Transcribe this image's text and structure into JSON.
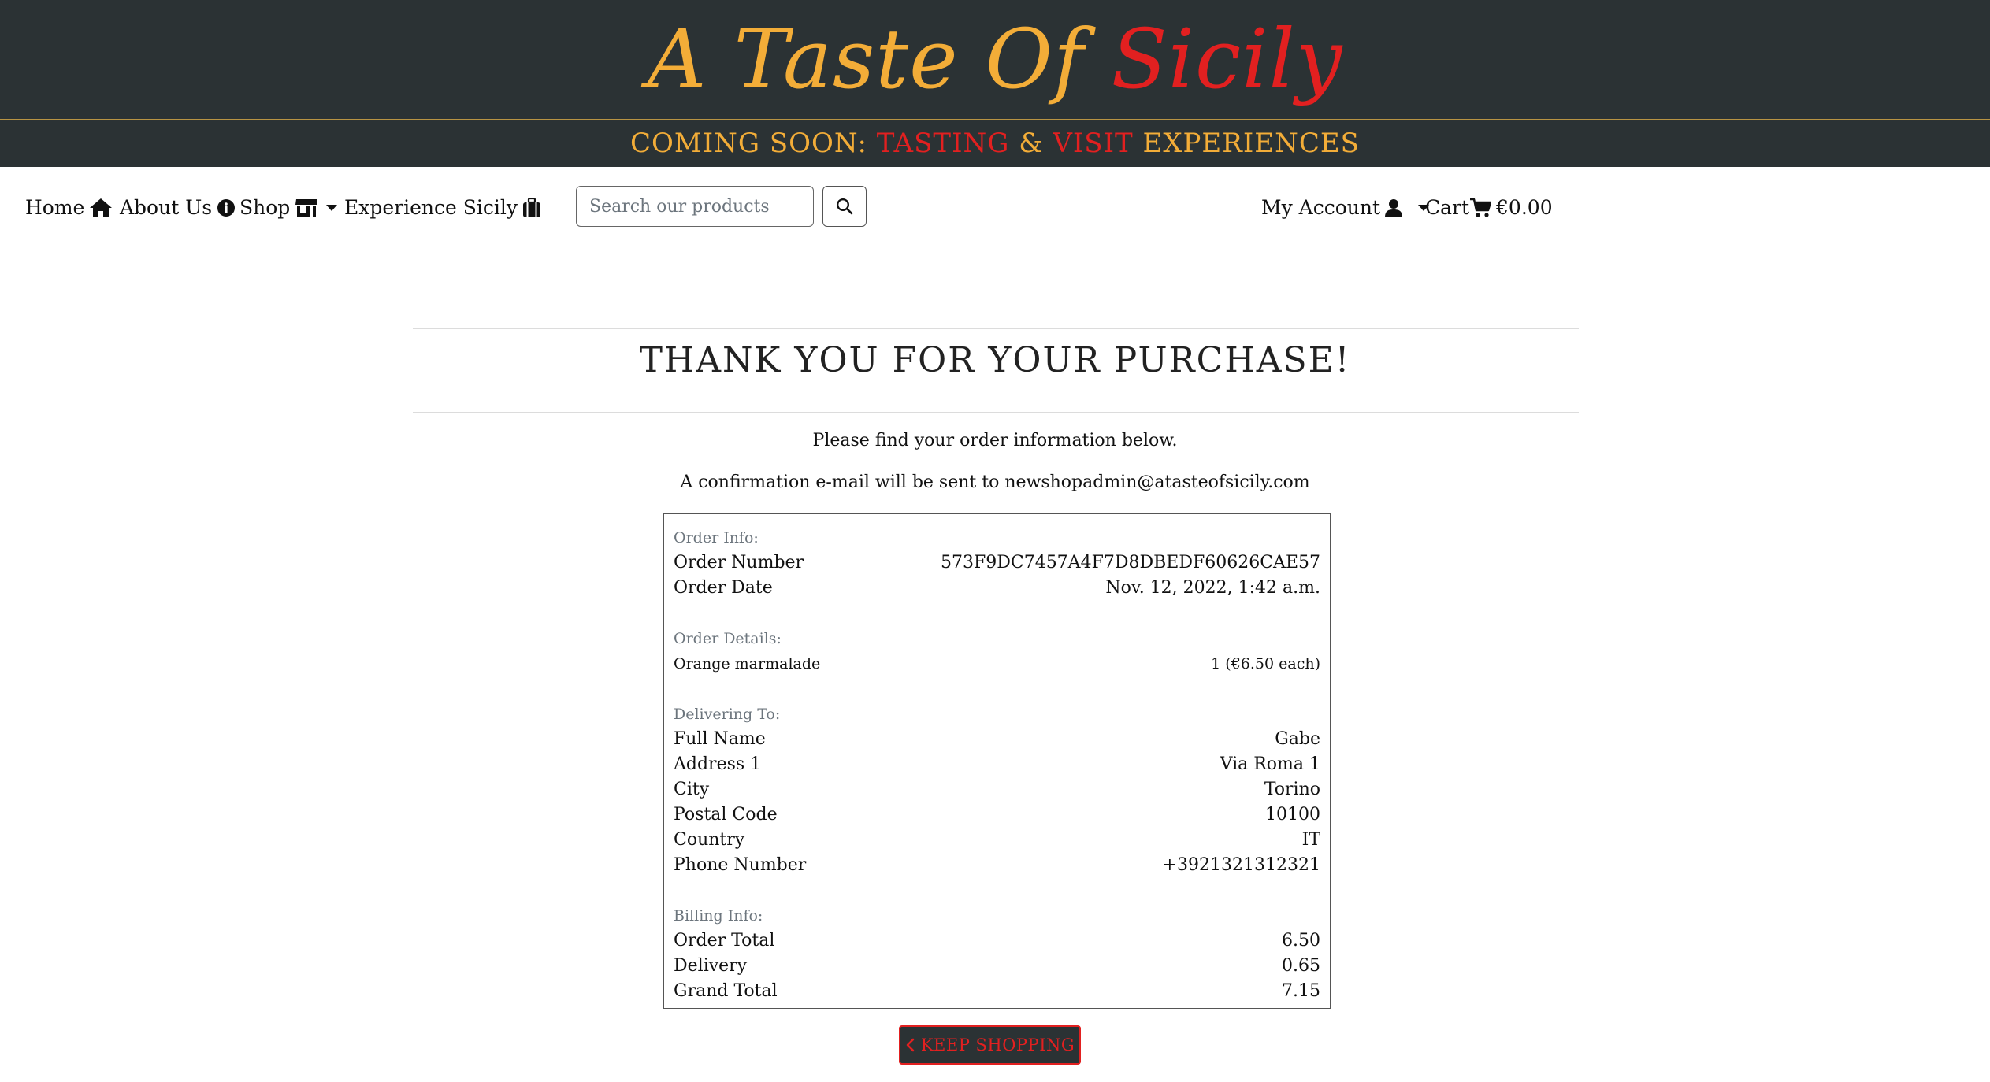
{
  "brand": {
    "word1": "A Taste",
    "word2": "Of",
    "word3": "Sicily"
  },
  "banner": {
    "part1": "COMING SOON: ",
    "part2": "TASTING",
    "part3": " & ",
    "part4": "VISIT",
    "part5": " EXPERIENCES"
  },
  "nav": {
    "home": "Home",
    "about": "About Us",
    "shop": "Shop",
    "experience": "Experience Sicily",
    "account": "My Account",
    "cart": "Cart",
    "cart_total": "€0.00"
  },
  "search": {
    "placeholder": "Search our products"
  },
  "main": {
    "title": "THANK YOU FOR YOUR PURCHASE!",
    "lead1": "Please find your order information below.",
    "lead2": "A confirmation e-mail will be sent to newshopadmin@atasteofsicily.com"
  },
  "order": {
    "info_label": "Order Info:",
    "number_label": "Order Number",
    "number_value": "573F9DC7457A4F7D8DBEDF60626CAE57",
    "date_label": "Order Date",
    "date_value": "Nov. 12, 2022, 1:42 a.m.",
    "details_label": "Order Details:",
    "items": [
      {
        "name": "Orange marmalade",
        "qty": "1 (€6.50 each)"
      }
    ],
    "delivering_label": "Delivering To:",
    "full_name_label": "Full Name",
    "full_name_value": "Gabe",
    "address1_label": "Address 1",
    "address1_value": "Via Roma 1",
    "city_label": "City",
    "city_value": "Torino",
    "postal_label": "Postal Code",
    "postal_value": "10100",
    "country_label": "Country",
    "country_value": "IT",
    "phone_label": "Phone Number",
    "phone_value": "+3921321312321",
    "billing_label": "Billing Info:",
    "order_total_label": "Order Total",
    "order_total_value": "6.50",
    "delivery_label": "Delivery",
    "delivery_value": "0.65",
    "grand_total_label": "Grand Total",
    "grand_total_value": "7.15"
  },
  "keep_shopping": "KEEP SHOPPING",
  "colors": {
    "header_bg": "#2b3234",
    "brand_yellow": "#f3ad38",
    "brand_red": "#e22020"
  }
}
